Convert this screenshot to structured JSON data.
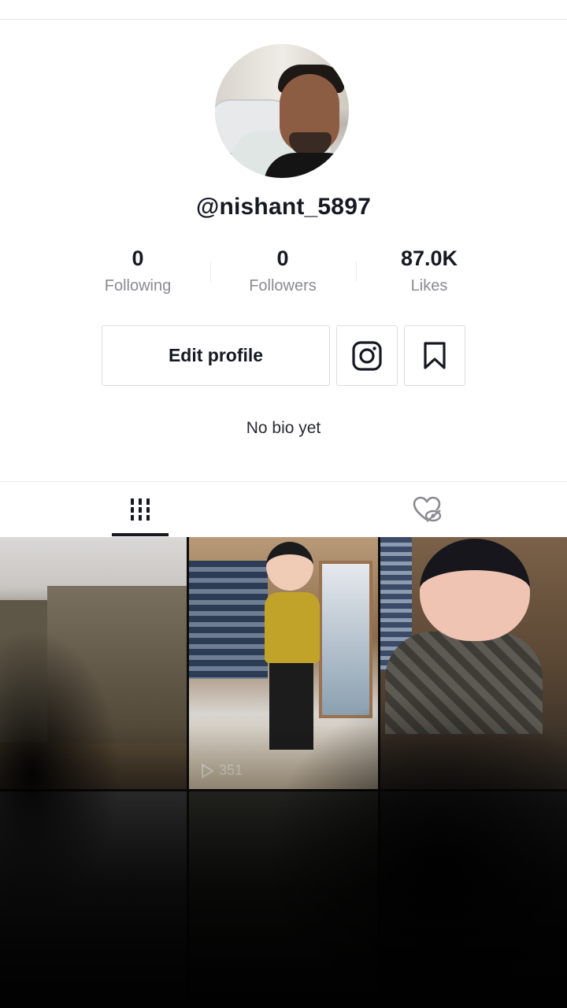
{
  "profile": {
    "username": "@nishant_5897",
    "bio": "No bio yet"
  },
  "stats": [
    {
      "value": "0",
      "label": "Following"
    },
    {
      "value": "0",
      "label": "Followers"
    },
    {
      "value": "87.0K",
      "label": "Likes"
    }
  ],
  "actions": {
    "edit_profile_label": "Edit profile",
    "instagram_icon": "instagram-icon",
    "bookmark_icon": "bookmark-icon"
  },
  "tabs": {
    "videos_icon": "grid-icon",
    "liked_icon": "hidden-heart-icon",
    "active": "videos"
  },
  "videos": [
    {
      "views": ""
    },
    {
      "views": "351"
    },
    {
      "views": ""
    },
    {
      "views": ""
    },
    {
      "views": ""
    },
    {
      "views": ""
    }
  ],
  "colors": {
    "text": "#161823",
    "secondary_text": "#8a8b91",
    "border": "#dcdce0"
  }
}
